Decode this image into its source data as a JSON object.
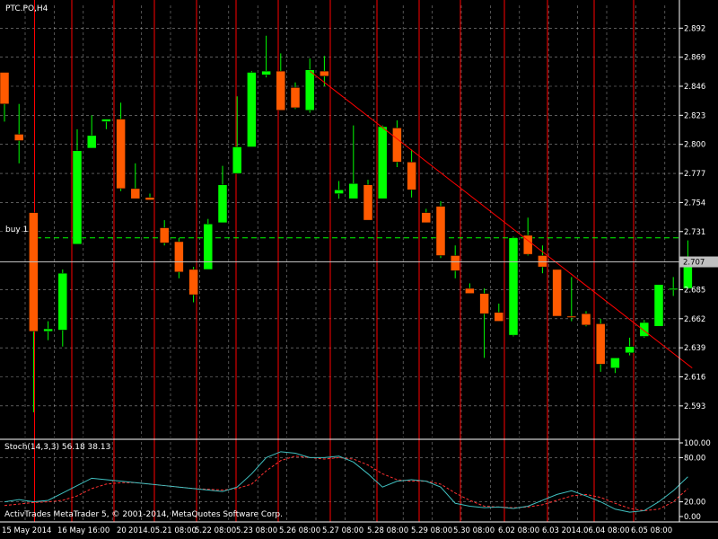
{
  "chart_data": {
    "type": "candlestick",
    "title": "PTC.PO,H4",
    "y_ticks": [
      "2.892",
      "2.869",
      "2.846",
      "2.823",
      "2.800",
      "2.777",
      "2.754",
      "2.731",
      "2.707",
      "2.685",
      "2.662",
      "2.639",
      "2.616",
      "2.593"
    ],
    "ylim": [
      2.568,
      2.91
    ],
    "current_price": "2.707",
    "buy_label": "buy 1",
    "buy_level": 2.726,
    "colors": {
      "bull": "#00ff00",
      "bear": "#ff5a00",
      "grid": "#c0c0c0",
      "vline": "#ff0000",
      "trend": "#ff0000",
      "stoch_main": "#40c0c0",
      "stoch_signal": "#ff3030"
    },
    "candles": [
      [
        2.857,
        2.857,
        2.818,
        2.832
      ],
      [
        2.808,
        2.832,
        2.785,
        2.803
      ],
      [
        2.746,
        2.746,
        2.588,
        2.652
      ],
      [
        2.652,
        2.66,
        2.645,
        2.654
      ],
      [
        2.653,
        2.701,
        2.64,
        2.698
      ],
      [
        2.721,
        2.812,
        2.721,
        2.795
      ],
      [
        2.797,
        2.823,
        2.797,
        2.807
      ],
      [
        2.818,
        2.82,
        2.812,
        2.82
      ],
      [
        2.82,
        2.833,
        2.763,
        2.765
      ],
      [
        2.765,
        2.785,
        2.758,
        2.757
      ],
      [
        2.758,
        2.761,
        2.756,
        2.756
      ],
      [
        2.734,
        2.74,
        2.72,
        2.722
      ],
      [
        2.723,
        2.726,
        2.694,
        2.699
      ],
      [
        2.701,
        2.703,
        2.675,
        2.681
      ],
      [
        2.701,
        2.741,
        2.701,
        2.737
      ],
      [
        2.738,
        2.783,
        2.738,
        2.768
      ],
      [
        2.777,
        2.838,
        2.777,
        2.798
      ],
      [
        2.798,
        2.858,
        2.798,
        2.857
      ],
      [
        2.855,
        2.886,
        2.853,
        2.858
      ],
      [
        2.858,
        2.872,
        2.828,
        2.827
      ],
      [
        2.845,
        2.849,
        2.828,
        2.829
      ],
      [
        2.827,
        2.868,
        2.825,
        2.859
      ],
      [
        2.858,
        2.87,
        2.846,
        2.854
      ],
      [
        2.761,
        2.771,
        2.757,
        2.764
      ],
      [
        2.757,
        2.815,
        2.757,
        2.769
      ],
      [
        2.768,
        2.772,
        2.742,
        2.74
      ],
      [
        2.757,
        2.815,
        2.757,
        2.814
      ],
      [
        2.813,
        2.819,
        2.782,
        2.786
      ],
      [
        2.786,
        2.796,
        2.758,
        2.764
      ],
      [
        2.746,
        2.749,
        2.738,
        2.738
      ],
      [
        2.751,
        2.755,
        2.71,
        2.712
      ],
      [
        2.712,
        2.72,
        2.694,
        2.7
      ],
      [
        2.686,
        2.69,
        2.682,
        2.682
      ],
      [
        2.682,
        2.686,
        2.631,
        2.666
      ],
      [
        2.667,
        2.674,
        2.66,
        2.66
      ],
      [
        2.649,
        2.727,
        2.648,
        2.726
      ],
      [
        2.728,
        2.742,
        2.712,
        2.713
      ],
      [
        2.712,
        2.72,
        2.698,
        2.703
      ],
      [
        2.701,
        2.701,
        2.665,
        2.664
      ],
      [
        2.664,
        2.695,
        2.66,
        2.663
      ],
      [
        2.666,
        2.668,
        2.656,
        2.657
      ],
      [
        2.658,
        2.662,
        2.62,
        2.626
      ],
      [
        2.623,
        2.629,
        2.619,
        2.631
      ],
      [
        2.635,
        2.647,
        2.633,
        2.64
      ],
      [
        2.648,
        2.661,
        2.647,
        2.659
      ],
      [
        2.656,
        2.689,
        2.656,
        2.689
      ],
      [
        2.686,
        2.695,
        2.68,
        2.686
      ],
      [
        2.686,
        2.724,
        2.686,
        2.71
      ]
    ],
    "trendline": {
      "from": [
        21,
        2.858
      ],
      "to": [
        47.3,
        2.623
      ]
    },
    "stochastic": {
      "label": "Stoch(14,3,3) 56.18 38.13",
      "y_ticks": [
        "100.00",
        "80.00",
        "20.00",
        "0.00"
      ],
      "ylim": [
        0,
        100
      ],
      "main": [
        20,
        23,
        20,
        22,
        32,
        42,
        52,
        50,
        48,
        46,
        44,
        42,
        40,
        38,
        36,
        34,
        40,
        58,
        80,
        88,
        86,
        80,
        80,
        82,
        74,
        58,
        40,
        48,
        50,
        48,
        40,
        18,
        14,
        12,
        13,
        11,
        14,
        22,
        30,
        35,
        28,
        20,
        10,
        6,
        8,
        20,
        35,
        54
      ],
      "signal": [
        15,
        17,
        19,
        20,
        22,
        28,
        38,
        44,
        46,
        46,
        44,
        42,
        40,
        38,
        37,
        36,
        38,
        44,
        62,
        76,
        82,
        80,
        78,
        80,
        78,
        70,
        58,
        50,
        48,
        48,
        44,
        32,
        22,
        14,
        13,
        12,
        13,
        16,
        22,
        28,
        30,
        26,
        18,
        11,
        8,
        10,
        20,
        38
      ]
    },
    "x_labels": [
      "15 May 2014",
      "16 May 16:00",
      "20",
      "2014.05.21 08:00",
      "5.22 08:00",
      "5.23 08:00",
      "5.26 08:00",
      "5.27 08:00",
      "5.28 08:00",
      "5.29 08:00",
      "5.30 08:00",
      "6.02 08:00",
      "6.03 2014.06.04 08:00",
      "6.05 08:00"
    ],
    "copyright": "ActivTrades MetaTrader 5, © 2001-2014, MetaQuotes Software Corp."
  }
}
